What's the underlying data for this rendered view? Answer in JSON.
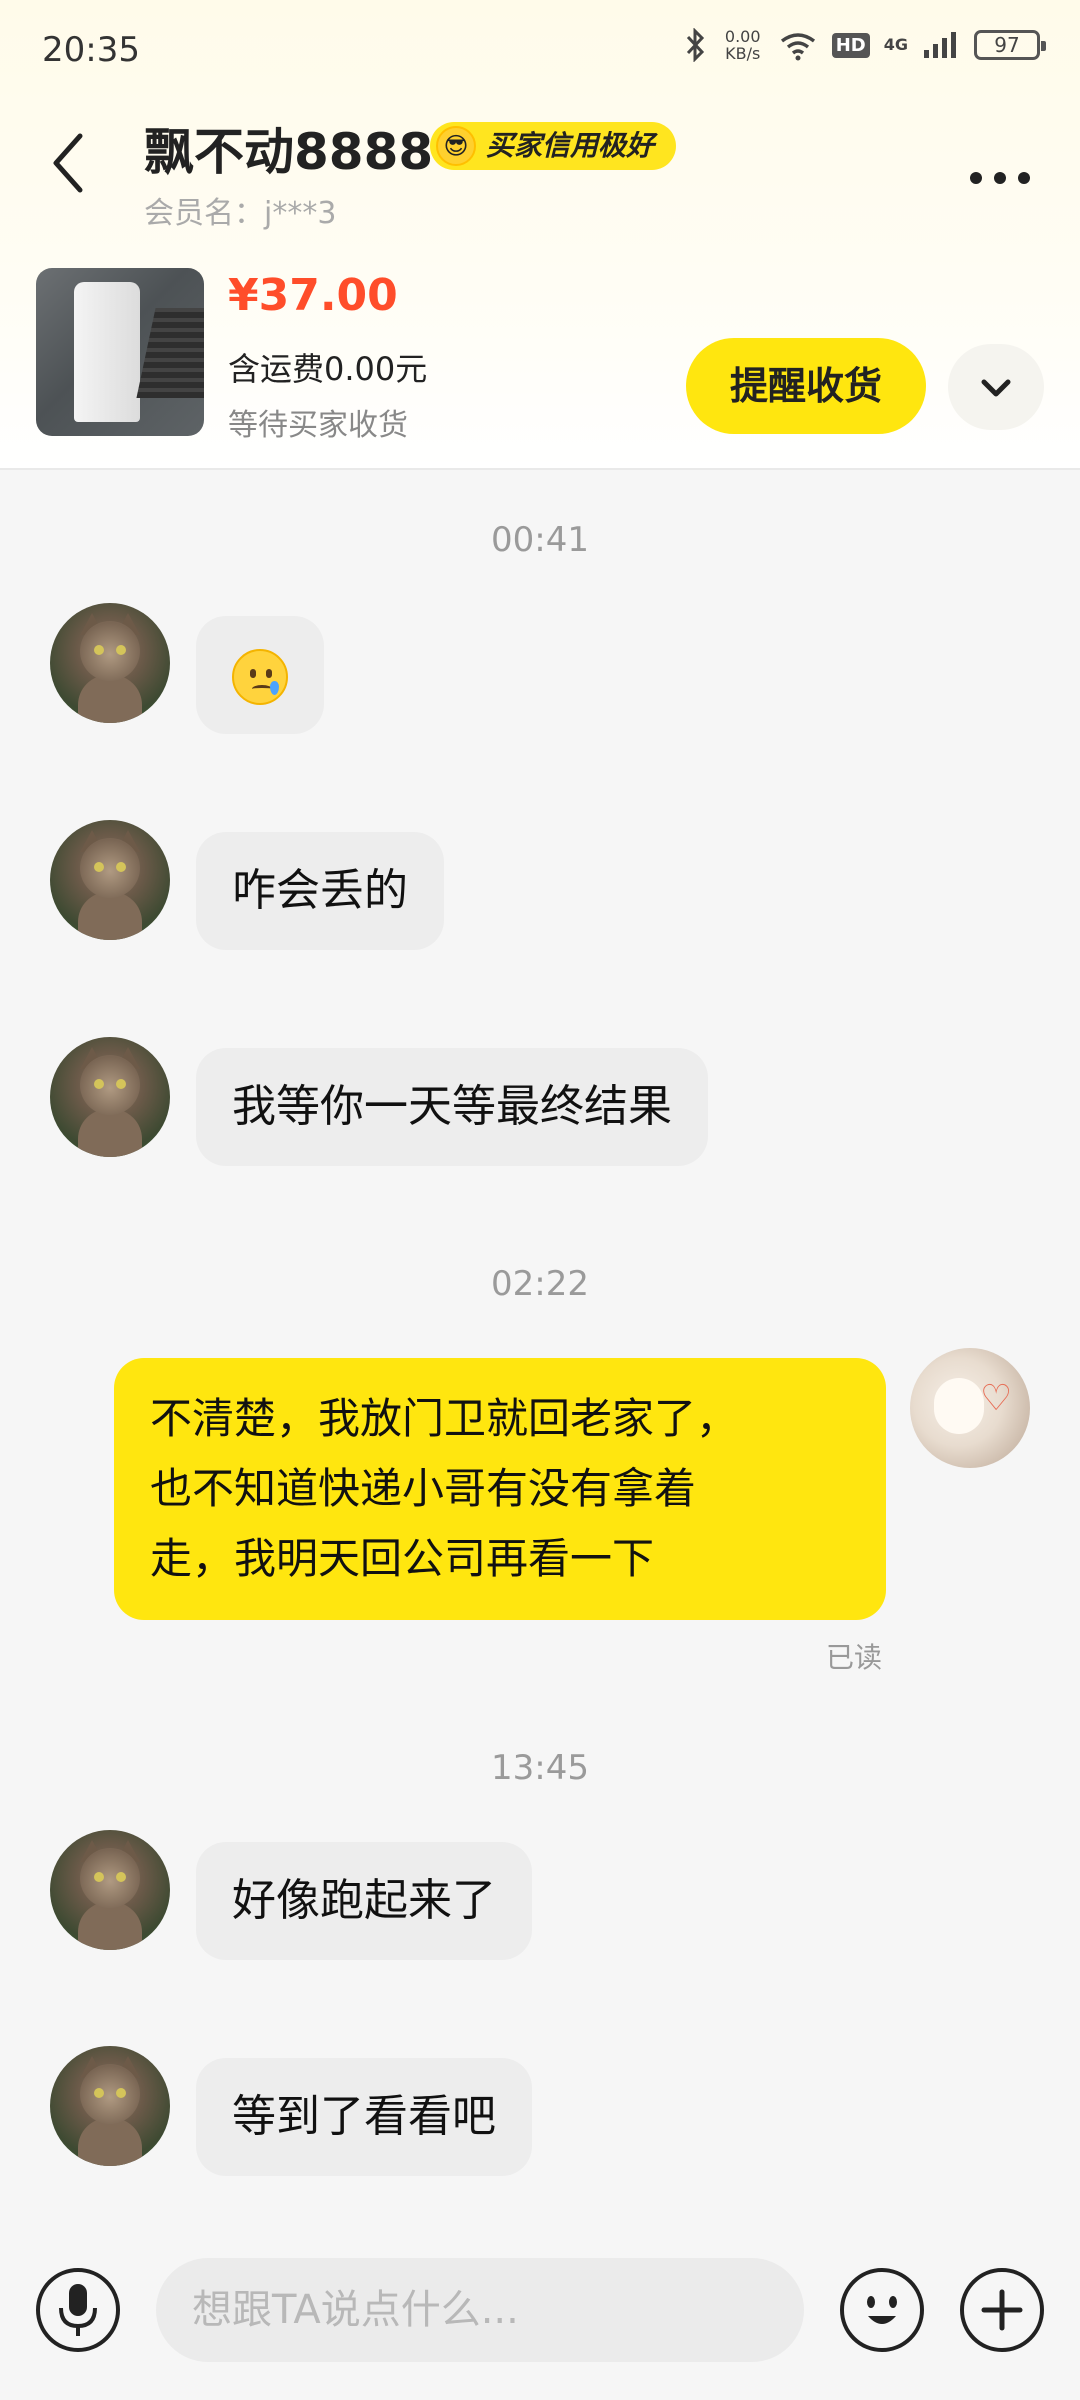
{
  "status_bar": {
    "time": "20:35",
    "net_speed_value": "0.00",
    "net_speed_unit": "KB/s",
    "hd": "HD",
    "network": "4G",
    "battery": "97"
  },
  "header": {
    "title": "飘不动8888",
    "badge": "买家信用极好",
    "member": "会员名：j***3"
  },
  "order": {
    "price": "¥37.00",
    "shipping": "含运费0.00元",
    "status": "等待买家收货",
    "remind_button": "提醒收货"
  },
  "chat": {
    "timestamps": [
      "00:41",
      "02:22",
      "13:45"
    ],
    "messages": [
      {
        "from": "other",
        "text": ""
      },
      {
        "from": "other",
        "text": "咋会丢的"
      },
      {
        "from": "other",
        "text": "我等你一天等最终结果"
      },
      {
        "from": "me",
        "lines": [
          "不清楚，我放门卫就回老家了，",
          "也不知道快递小哥有没有拿着",
          "走，我明天回公司再看一下"
        ],
        "read": "已读"
      },
      {
        "from": "other",
        "text": "好像跑起来了"
      },
      {
        "from": "other",
        "text": "等到了看看吧"
      }
    ]
  },
  "input": {
    "placeholder": "想跟TA说点什么..."
  },
  "colors": {
    "accent_yellow": "#ffe60f",
    "price_red": "#ff4d2a"
  },
  "icons": [
    "back-arrow-icon",
    "more-icon",
    "chevron-down-icon",
    "microphone-icon",
    "emoji-icon",
    "plus-icon",
    "bluetooth-icon",
    "wifi-icon",
    "signal-icon",
    "battery-icon"
  ]
}
